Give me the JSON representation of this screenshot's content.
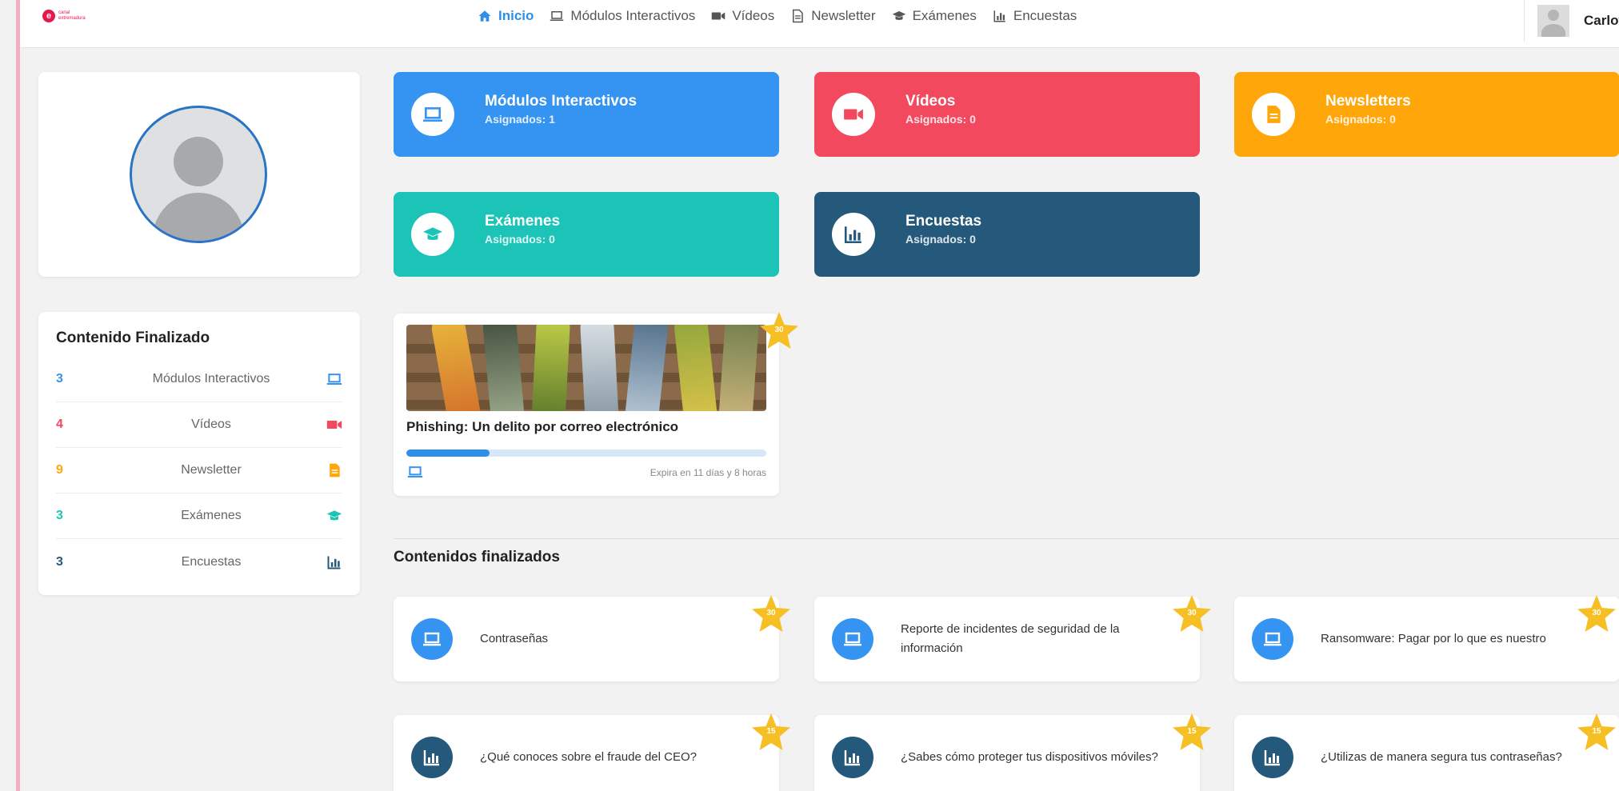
{
  "colors": {
    "blue": "#3594f2",
    "red": "#f2495e",
    "orange": "#ffa70a",
    "teal": "#1cc4b7",
    "navy": "#24597c",
    "star": "#f6bf24"
  },
  "brand": {
    "icon": "brand-logo-icon",
    "text": "canal extremadura"
  },
  "nav": [
    {
      "label": "Inicio",
      "icon": "home-icon",
      "active": true
    },
    {
      "label": "Módulos Interactivos",
      "icon": "laptop-icon",
      "active": false
    },
    {
      "label": "Vídeos",
      "icon": "video-icon",
      "active": false
    },
    {
      "label": "Newsletter",
      "icon": "document-icon",
      "active": false
    },
    {
      "label": "Exámenes",
      "icon": "graduation-cap-icon",
      "active": false
    },
    {
      "label": "Encuestas",
      "icon": "bar-chart-icon",
      "active": false
    }
  ],
  "user": {
    "name": "Carlota"
  },
  "tiles": [
    {
      "title": "Módulos Interactivos",
      "subtitle": "Asignados: 1",
      "icon": "laptop-icon"
    },
    {
      "title": "Vídeos",
      "subtitle": "Asignados: 0",
      "icon": "video-icon"
    },
    {
      "title": "Newsletters",
      "subtitle": "Asignados: 0",
      "icon": "document-icon"
    },
    {
      "title": "Exámenes",
      "subtitle": "Asignados: 0",
      "icon": "graduation-cap-icon"
    },
    {
      "title": "Encuestas",
      "subtitle": "Asignados: 0",
      "icon": "bar-chart-icon"
    }
  ],
  "finished": {
    "title": "Contenido Finalizado",
    "rows": [
      {
        "count": "3",
        "label": "Módulos Interactivos",
        "icon": "laptop-icon"
      },
      {
        "count": "4",
        "label": "Vídeos",
        "icon": "video-icon"
      },
      {
        "count": "9",
        "label": "Newsletter",
        "icon": "document-icon"
      },
      {
        "count": "3",
        "label": "Exámenes",
        "icon": "graduation-cap-icon"
      },
      {
        "count": "3",
        "label": "Encuestas",
        "icon": "bar-chart-icon"
      }
    ]
  },
  "in_progress": {
    "title": "Phishing: Un delito por correo electrónico",
    "points": "30",
    "progress": 0.23,
    "expires": "Expira en 11 días y 8 horas",
    "icon": "laptop-icon"
  },
  "completed_section": {
    "title": "Contenidos finalizados",
    "items": [
      {
        "title": "Contraseñas",
        "points": "30",
        "icon": "laptop-icon"
      },
      {
        "title": "Reporte de incidentes de seguridad de la información",
        "points": "30",
        "icon": "laptop-icon"
      },
      {
        "title": "Ransomware: Pagar por lo que es nuestro",
        "points": "30",
        "icon": "laptop-icon"
      },
      {
        "title": "¿Qué conoces sobre el fraude del CEO?",
        "points": "15",
        "icon": "bar-chart-icon"
      },
      {
        "title": "¿Sabes cómo proteger tus dispositivos móviles?",
        "points": "15",
        "icon": "bar-chart-icon"
      },
      {
        "title": "¿Utilizas de manera segura tus contraseñas?",
        "points": "15",
        "icon": "bar-chart-icon"
      }
    ]
  }
}
